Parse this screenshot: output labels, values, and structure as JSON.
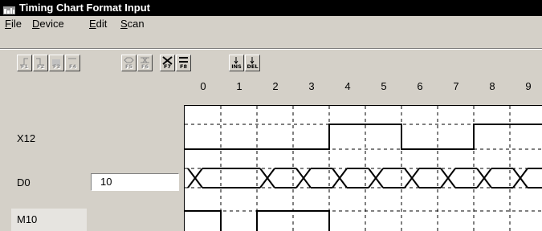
{
  "window": {
    "title": "Timing Chart Format Input"
  },
  "menu": {
    "file": {
      "mnemonic": "F",
      "rest": "ile"
    },
    "device": {
      "mnemonic": "D",
      "rest": "evice"
    },
    "edit": {
      "mnemonic": "E",
      "rest": "dit"
    },
    "scan": {
      "mnemonic": "S",
      "rest": "can"
    }
  },
  "toolbar": {
    "buttons": [
      {
        "label": "F1",
        "state": "disabled"
      },
      {
        "label": "F2",
        "state": "disabled"
      },
      {
        "label": "F3",
        "state": "disabled"
      },
      {
        "label": "F4",
        "state": "disabled"
      },
      {
        "label": "F5",
        "state": "disabled"
      },
      {
        "label": "F6",
        "state": "disabled"
      },
      {
        "label": "F7",
        "state": "enabled"
      },
      {
        "label": "F8",
        "state": "enabled"
      },
      {
        "label": "INS",
        "state": "enabled"
      },
      {
        "label": "DEL",
        "state": "enabled"
      }
    ]
  },
  "chart": {
    "columns": [
      "0",
      "1",
      "2",
      "3",
      "4",
      "5",
      "6",
      "7",
      "8",
      "9"
    ],
    "signals": [
      {
        "device": "X12",
        "type": "bit",
        "levels": [
          0,
          0,
          0,
          0,
          1,
          1,
          0,
          0,
          1,
          1
        ]
      },
      {
        "device": "D0",
        "type": "word",
        "value": "10",
        "transitions": [
          0,
          2,
          3,
          4,
          5,
          6,
          7,
          8,
          9
        ]
      },
      {
        "device": "M10",
        "type": "bit",
        "levels": [
          1,
          0,
          1,
          1,
          0,
          0,
          0,
          0,
          0,
          0
        ]
      }
    ]
  }
}
